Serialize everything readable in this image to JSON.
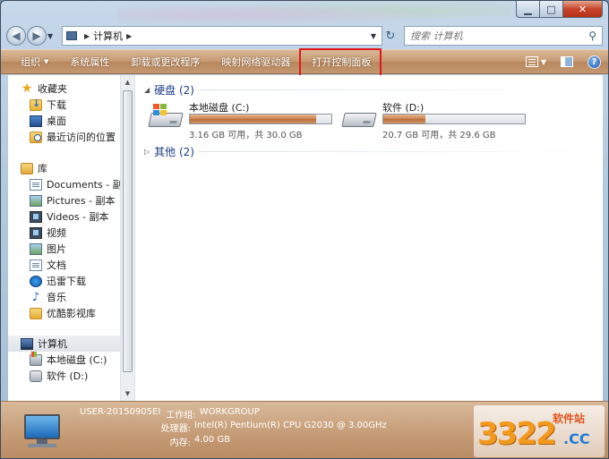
{
  "address": {
    "crumb": "计算机",
    "search_placeholder": "搜索 计算机"
  },
  "toolbar": {
    "organize": "组织",
    "system_properties": "系统属性",
    "uninstall": "卸载或更改程序",
    "map_drive": "映射网络驱动器",
    "open_control_panel": "打开控制面板"
  },
  "nav": {
    "favorites": "收藏夹",
    "downloads": "下载",
    "desktop": "桌面",
    "recent": "最近访问的位置",
    "libraries": "库",
    "documents_copy": "Documents - 副本",
    "pictures_copy": "Pictures - 副本",
    "videos_copy": "Videos - 副本",
    "video": "视频",
    "pictures": "图片",
    "documents": "文档",
    "xunlei": "迅雷下载",
    "music": "音乐",
    "youku": "优酷影视库",
    "computer": "计算机",
    "drive_c": "本地磁盘 (C:)",
    "drive_d": "软件 (D:)"
  },
  "content": {
    "group_hdd": "硬盘 (2)",
    "group_other": "其他 (2)",
    "drives": [
      {
        "name": "本地磁盘 (C:)",
        "free_text": "3.16 GB 可用，共 30.0 GB",
        "used_fraction": 0.895
      },
      {
        "name": "软件 (D:)",
        "free_text": "20.7 GB 可用，共 29.6 GB",
        "used_fraction": 0.3
      }
    ]
  },
  "details": {
    "computer_name": "USER-20150905EI",
    "workgroup_label": "工作组:",
    "workgroup_value": "WORKGROUP",
    "processor_label": "处理器:",
    "processor_value": "Intel(R) Pentium(R) CPU G2030 @ 3.00GHz",
    "memory_label": "内存:",
    "memory_value": "4.00 GB"
  },
  "watermark": {
    "number": "3322",
    "site": "软件站",
    "tld": ".CC"
  },
  "colors": {
    "toolbar": "#c69a72",
    "highlight_box": "#e3161c",
    "link_blue": "#1f3c88",
    "bar_fill": "#c98350"
  }
}
